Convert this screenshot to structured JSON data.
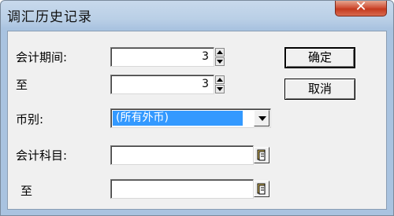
{
  "window": {
    "title": "调汇历史记录",
    "close_glyph": "✕"
  },
  "form": {
    "period_label": "会计期间:",
    "period_value": "3",
    "to_label_1": "至",
    "period_to_value": "3",
    "currency_label": "币别:",
    "currency_selected": "(所有外币)",
    "account_label": "会计科目:",
    "account_value": "",
    "to_label_2": "至",
    "account_to_value": ""
  },
  "buttons": {
    "ok": "确定",
    "cancel": "取消"
  },
  "icons": {
    "spin": "spinner-arrows-icon",
    "dropdown": "chevron-down-icon",
    "lookup": "book-lookup-icon"
  },
  "colors": {
    "selection": "#3399ff",
    "close_button": "#c43a1f",
    "title_bar": "#b9cfe6"
  }
}
